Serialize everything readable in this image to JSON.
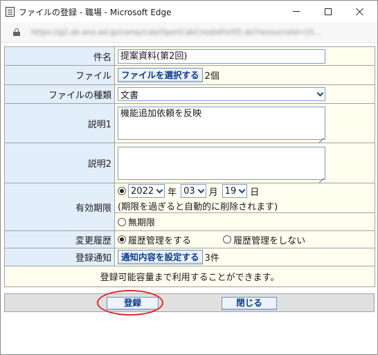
{
  "window": {
    "title": "ファイルの登録 - 職場 - Microsoft Edge",
    "url": "https://g2.ak.ano.ad.jp/comp/cab/OpenCabCreateFor05.do?resourceId=15..."
  },
  "form": {
    "name": {
      "label": "件名",
      "value": "提案資料(第2回)"
    },
    "file": {
      "label": "ファイル",
      "button": "ファイルを選択する",
      "count": "2個"
    },
    "type": {
      "label": "ファイルの種類",
      "selected": "文書"
    },
    "desc1": {
      "label": "説明1",
      "value": "機能追加依頼を反映"
    },
    "desc2": {
      "label": "説明2",
      "value": ""
    },
    "expiry": {
      "label": "有効期限",
      "year": "2022",
      "year_unit": "年",
      "month": "03",
      "month_unit": "月",
      "day": "19",
      "day_unit": "日",
      "note": "(期限を過ぎると自動的に削除されます)",
      "unlimited_label": "無期限",
      "dated_selected": true
    },
    "history": {
      "label": "変更履歴",
      "option_on": "履歴管理をする",
      "option_off": "履歴管理をしない",
      "on_selected": true
    },
    "notify": {
      "label": "登録通知",
      "button": "通知内容を設定する",
      "count": "3件"
    },
    "capacity_note": "登録可能容量まで利用することができます。"
  },
  "footer": {
    "register_label": "登録",
    "close_label": "閉じる"
  },
  "colors": {
    "label_bg": "#e3eefb",
    "value_bg": "#fffff0",
    "button_text": "#0a3a8a",
    "highlight": "#e0262a"
  }
}
